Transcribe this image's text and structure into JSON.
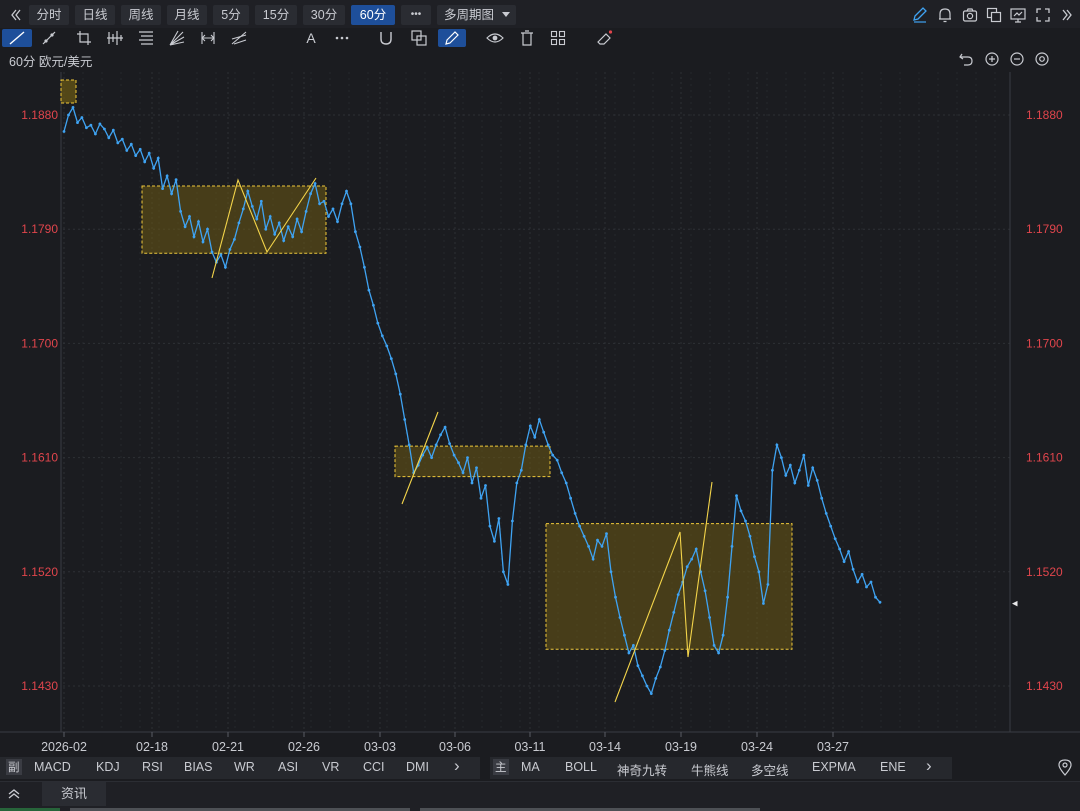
{
  "period_bar": {
    "collapse_icon": "double-chevron-left-icon",
    "periods": [
      "分时",
      "日线",
      "周线",
      "月线",
      "5分",
      "15分",
      "30分",
      "60分"
    ],
    "active_period": "60分",
    "more_label": "•••",
    "multi_period_label": "多周期图",
    "right_icons": [
      "pen-icon",
      "bell-icon",
      "camera-icon",
      "copy-window-icon",
      "monitor-icon",
      "fullscreen-icon",
      "double-chevron-right-icon"
    ]
  },
  "draw_bar": {
    "tools": [
      "line-tool-icon",
      "ray-tool-icon",
      "crop-tool-icon",
      "bars-tool-icon",
      "fib-tool-icon",
      "fan-tool-icon",
      "measure-tool-icon",
      "pitchfork-tool-icon",
      "text-tool-icon",
      "more-tools-icon",
      "magnet-icon",
      "layers-icon",
      "brush-icon",
      "eye-icon",
      "trash-icon",
      "grid-icon",
      "eraser-icon"
    ]
  },
  "chart_header": {
    "title": "60分 欧元/美元",
    "icons": [
      "undo-icon",
      "zoom-in-icon",
      "zoom-out-icon",
      "settings-icon"
    ]
  },
  "colors": {
    "background": "#1b1c20",
    "price_line": "#3fa3f2",
    "axis_text": "#e0454c",
    "box_fill": "#6b5a14",
    "box_border": "#f0c93a",
    "grid": "#2e3035"
  },
  "chart_data": {
    "type": "line",
    "title": "",
    "symbol": "欧元/美元",
    "period": "60分",
    "y_ticks": [
      1.188,
      1.179,
      1.17,
      1.161,
      1.152,
      1.143
    ],
    "y_tick_labels": [
      "1.1880",
      "1.1790",
      "1.1700",
      "1.1610",
      "1.1520",
      "1.1430"
    ],
    "ylim": [
      1.1405,
      1.1905
    ],
    "x_tick_labels": [
      "2026-02",
      "02-18",
      "02-21",
      "02-26",
      "03-03",
      "03-06",
      "03-11",
      "03-14",
      "03-19",
      "03-24",
      "03-27"
    ],
    "series": [
      {
        "values": [
          1.1867,
          1.188,
          1.1886,
          1.1874,
          1.1878,
          1.187,
          1.1872,
          1.1865,
          1.1873,
          1.1869,
          1.1862,
          1.1868,
          1.1858,
          1.1861,
          1.1852,
          1.1857,
          1.1848,
          1.1853,
          1.1843,
          1.185,
          1.1838,
          1.1846,
          1.1822,
          1.1832,
          1.1818,
          1.1829,
          1.1804,
          1.1792,
          1.18,
          1.1784,
          1.1796,
          1.178,
          1.179,
          1.1772,
          1.1764,
          1.177,
          1.176,
          1.1774,
          1.1782,
          1.1795,
          1.1806,
          1.182,
          1.1808,
          1.1798,
          1.1812,
          1.179,
          1.18,
          1.1786,
          1.1795,
          1.1781,
          1.1792,
          1.1784,
          1.1798,
          1.1788,
          1.1804,
          1.1818,
          1.1826,
          1.181,
          1.1812,
          1.18,
          1.1806,
          1.1796,
          1.181,
          1.182,
          1.181,
          1.1788,
          1.1776,
          1.176,
          1.1742,
          1.173,
          1.1716,
          1.1706,
          1.1698,
          1.1688,
          1.1676,
          1.166,
          1.164,
          1.162,
          1.1598,
          1.1604,
          1.1612,
          1.1618,
          1.161,
          1.162,
          1.1628,
          1.1634,
          1.1621,
          1.1612,
          1.1606,
          1.1598,
          1.161,
          1.159,
          1.1602,
          1.1578,
          1.1588,
          1.1556,
          1.1544,
          1.1562,
          1.152,
          1.151,
          1.156,
          1.159,
          1.16,
          1.162,
          1.1635,
          1.1626,
          1.164,
          1.163,
          1.162,
          1.1612,
          1.1608,
          1.1598,
          1.159,
          1.1578,
          1.1566,
          1.1556,
          1.1548,
          1.154,
          1.153,
          1.1545,
          1.154,
          1.155,
          1.152,
          1.15,
          1.1484,
          1.147,
          1.1456,
          1.1462,
          1.1446,
          1.1438,
          1.143,
          1.1424,
          1.1436,
          1.1445,
          1.1458,
          1.1474,
          1.1488,
          1.1502,
          1.1512,
          1.1524,
          1.153,
          1.1538,
          1.152,
          1.1505,
          1.1484,
          1.1462,
          1.1456,
          1.147,
          1.15,
          1.154,
          1.158,
          1.1568,
          1.156,
          1.1548,
          1.1532,
          1.152,
          1.1495,
          1.151,
          1.16,
          1.162,
          1.161,
          1.1596,
          1.1604,
          1.159,
          1.16,
          1.1612,
          1.1588,
          1.1602,
          1.1592,
          1.1578,
          1.1566,
          1.1556,
          1.1546,
          1.1538,
          1.1528,
          1.1536,
          1.1522,
          1.1512,
          1.1518,
          1.1508,
          1.1512,
          1.15,
          1.1496
        ]
      }
    ],
    "zones": [
      {
        "x_start": 0.121,
        "x_end": 0.42,
        "y_low": 1.1771,
        "y_high": 1.1824
      },
      {
        "x_start": 0.558,
        "x_end": 0.79,
        "y_low": 1.1595,
        "y_high": 1.1619
      },
      {
        "x_start": 0.776,
        "x_end": 1.183,
        "y_low": 1.1459,
        "y_high": 1.1558
      }
    ],
    "current_marker": "◂",
    "grid": true,
    "legend": false
  },
  "indicators": {
    "sub_tag": "副",
    "sub_items": [
      "MACD",
      "KDJ",
      "RSI",
      "BIAS",
      "WR",
      "ASI",
      "VR",
      "CCI",
      "DMI"
    ],
    "main_tag": "主",
    "main_items": [
      "MA",
      "BOLL",
      "神奇九转",
      "牛熊线",
      "多空线",
      "EXPMA",
      "ENE"
    ],
    "next_label": "›",
    "pin_icon": "location-pin-icon"
  },
  "info_bar": {
    "collapse_icon": "double-chevron-up-icon",
    "tab_label": "资讯"
  }
}
